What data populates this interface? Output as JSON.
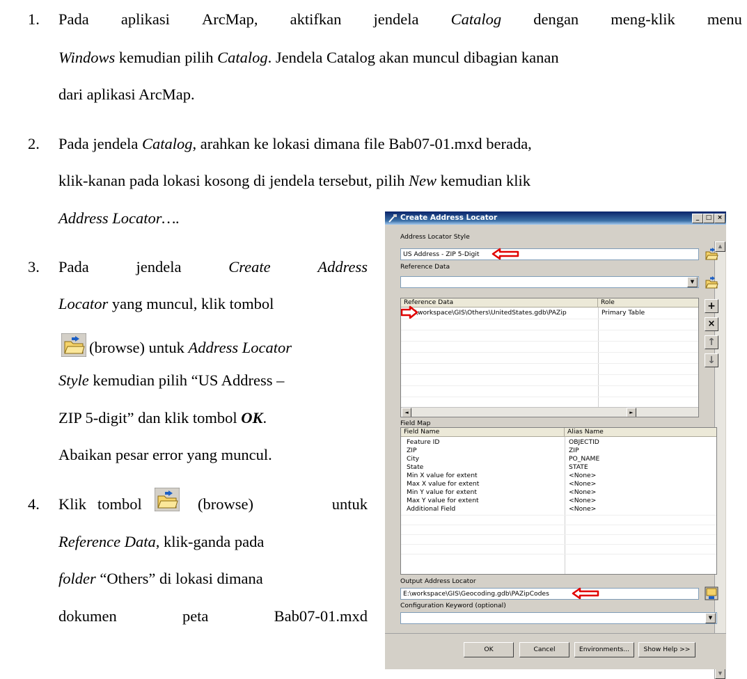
{
  "doc": {
    "item1": {
      "num": "1.",
      "line1_words": [
        "Pada",
        "aplikasi",
        "ArcMap,",
        "aktifkan",
        "jendela",
        "Catalog",
        "dengan",
        "meng-klik",
        "menu"
      ],
      "line2_a": "Windows",
      "line2_b": " kemudian pilih ",
      "line2_c": "Catalog",
      "line2_d": ". Jendela Catalog akan muncul dibagian kanan",
      "line3": "dari aplikasi ArcMap."
    },
    "item2": {
      "num": "2.",
      "line1_a": "Pada jendela ",
      "line1_b": "Catalog",
      "line1_c": ", arahkan ke lokasi dimana file Bab07-01.mxd berada,",
      "line2_a": "klik-kanan pada lokasi kosong di jendela tersebut, pilih ",
      "line2_b": "New",
      "line2_c": " kemudian klik",
      "line3": "Address Locator…."
    },
    "item3": {
      "num": "3.",
      "line1_words": [
        "Pada",
        "jendela",
        "Create",
        "Address"
      ],
      "line2_a": "Locator",
      "line2_b": " yang muncul, klik tombol",
      "line3": "(browse) untuk ",
      "line3_b": "Address Locator",
      "line4_a": "Style",
      "line4_b": " kemudian pilih “US Address –",
      "line5_a": "ZIP 5-digit” dan klik tombol ",
      "line5_b": "OK",
      "line5_c": ".",
      "line6": "Abaikan pesar error yang muncul."
    },
    "item4": {
      "num": "4.",
      "line1_a": "Klik",
      "line1_b": "tombol",
      "line1_c": "(browse)",
      "line1_d": "untuk",
      "line2_a": "Reference Data",
      "line2_b": ", klik-ganda pada",
      "line3_a": "folder",
      "line3_b": " “Others” di lokasi dimana",
      "line4_words": [
        "dokumen",
        "peta",
        "Bab07-01.mxd"
      ]
    }
  },
  "dialog": {
    "title": "Create Address Locator",
    "style_label": "Address Locator Style",
    "style_value": "US Address - ZIP 5-Digit",
    "refdata_label": "Reference Data",
    "refdata_value": "",
    "ref_table": {
      "headers": [
        "Reference Data",
        "Role"
      ],
      "rows": [
        [
          "E:\\workspace\\GIS\\Others\\UnitedStates.gdb\\PAZip",
          "Primary Table"
        ]
      ]
    },
    "fieldmap_label": "Field Map",
    "field_table": {
      "headers": [
        "Field Name",
        "Alias Name"
      ],
      "rows": [
        [
          "Feature ID",
          "OBJECTID"
        ],
        [
          "ZIP",
          "ZIP"
        ],
        [
          "City",
          "PO_NAME"
        ],
        [
          "State",
          "STATE"
        ],
        [
          "Min X value for extent",
          "<None>"
        ],
        [
          "Max X value for extent",
          "<None>"
        ],
        [
          "Min Y value for extent",
          "<None>"
        ],
        [
          "Max Y value for extent",
          "<None>"
        ],
        [
          "Additional Field",
          "<None>"
        ]
      ]
    },
    "output_label": "Output Address Locator",
    "output_value": "E:\\workspace\\GIS\\Geocoding.gdb\\PAZipCodes",
    "config_label": "Configuration Keyword (optional)",
    "config_value": "",
    "buttons": {
      "ok": "OK",
      "cancel": "Cancel",
      "env": "Environments...",
      "help": "Show Help >>"
    },
    "win_buttons": {
      "min": "_",
      "max": "□",
      "close": "×"
    },
    "tool_glyphs": {
      "add": "+",
      "remove": "×",
      "up": "↑",
      "down": "↓",
      "dropdown": "▼"
    }
  },
  "colors": {
    "red_arrow": "#e00000",
    "title_bar": "#0a246a",
    "dialog_bg": "#d4d0c8"
  },
  "icons": [
    "folder-browse-icon",
    "add-icon",
    "remove-icon",
    "move-up-icon",
    "move-down-icon",
    "red-arrow-icon"
  ]
}
